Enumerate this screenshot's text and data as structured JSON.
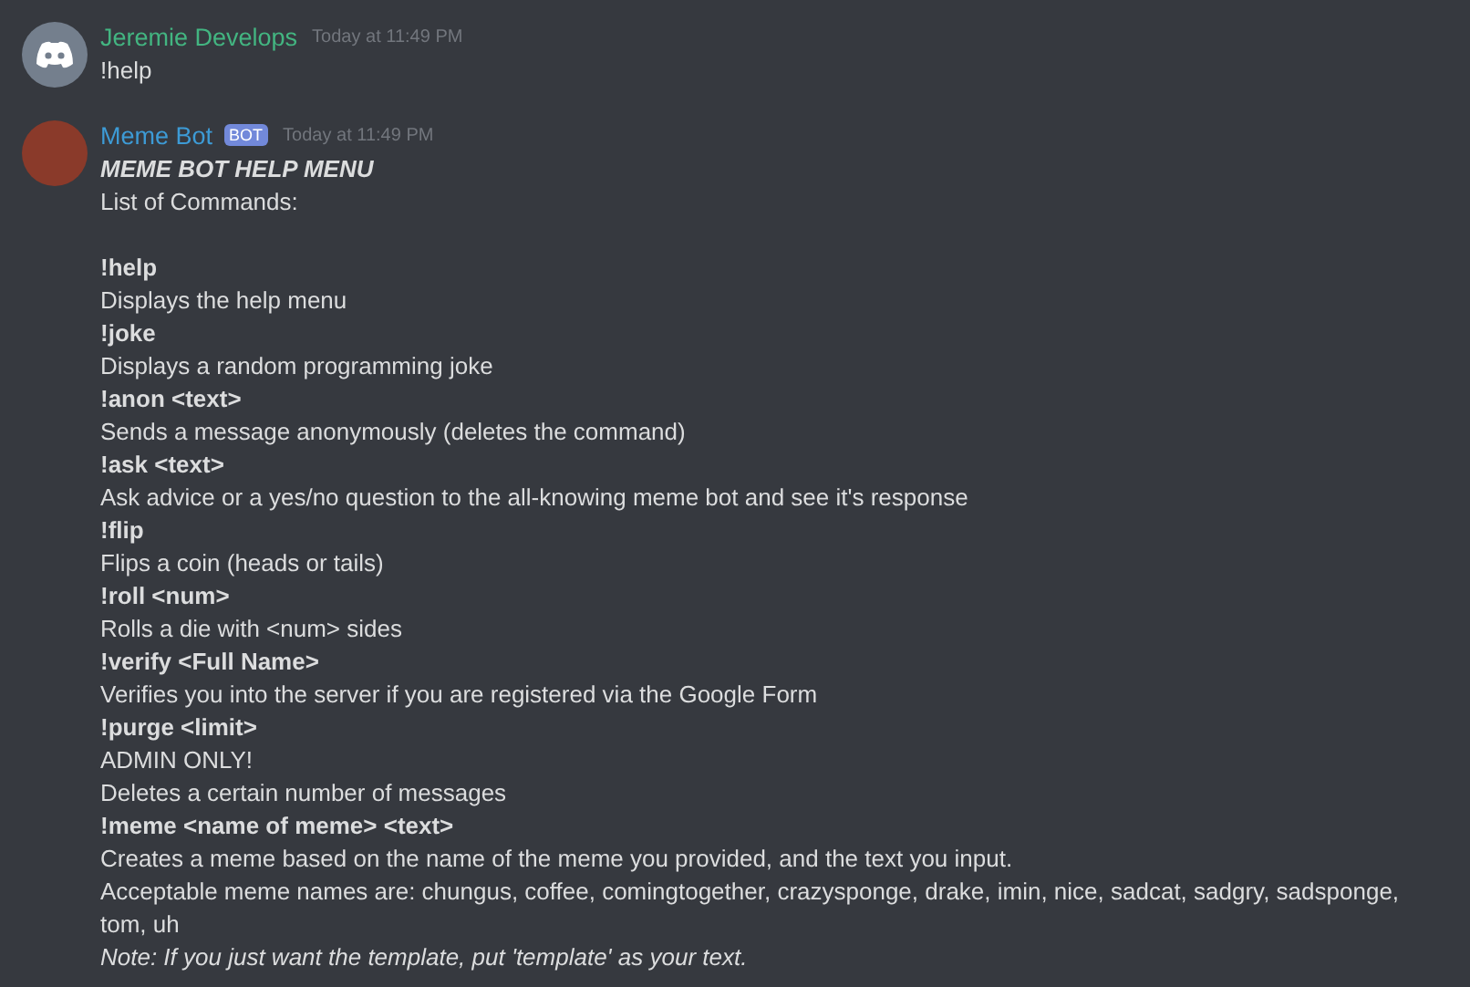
{
  "messages": [
    {
      "author": "Jeremie Develops",
      "color": "#43b581",
      "kind": "logo",
      "timestamp": "Today at 11:49 PM",
      "lines": [
        {
          "kind": "text",
          "text": "!help"
        }
      ]
    },
    {
      "author": "Meme Bot",
      "color": "#3d9bd6",
      "kind": "photo",
      "badge": "BOT",
      "timestamp": "Today at 11:49 PM",
      "lines": [
        {
          "kind": "heading",
          "text": "MEME BOT HELP MENU"
        },
        {
          "kind": "intro",
          "text": "List of Commands:"
        },
        {
          "kind": "command",
          "text": "!help"
        },
        {
          "kind": "text",
          "text": "Displays the help menu"
        },
        {
          "kind": "command",
          "text": "!joke"
        },
        {
          "kind": "text",
          "text": "Displays a random programming joke"
        },
        {
          "kind": "command",
          "text": "!anon <text>"
        },
        {
          "kind": "text",
          "text": "Sends a message anonymously (deletes the command)"
        },
        {
          "kind": "command",
          "text": "!ask <text>"
        },
        {
          "kind": "text",
          "text": "Ask advice or a yes/no question to the all-knowing meme bot and see it's response"
        },
        {
          "kind": "command",
          "text": "!flip"
        },
        {
          "kind": "text",
          "text": "Flips a coin (heads or tails)"
        },
        {
          "kind": "command",
          "text": "!roll <num>"
        },
        {
          "kind": "text",
          "text": "Rolls a die with <num> sides"
        },
        {
          "kind": "command",
          "text": "!verify <Full Name>"
        },
        {
          "kind": "text",
          "text": "Verifies you into the server if you are registered via the Google Form"
        },
        {
          "kind": "command",
          "text": "!purge <limit>"
        },
        {
          "kind": "text",
          "text": "ADMIN ONLY!"
        },
        {
          "kind": "text",
          "text": "Deletes a certain number of messages"
        },
        {
          "kind": "command",
          "text": "!meme <name of meme> <text>"
        },
        {
          "kind": "text",
          "text": "Creates a meme based on the name of the meme you provided, and the text you input."
        },
        {
          "kind": "text",
          "text": "Acceptable meme names are: chungus, coffee, comingtogether, crazysponge, drake, imin, nice, sadcat, sadgry, sadsponge, tom, uh"
        },
        {
          "kind": "note",
          "text": "Note: If you just want the template, put 'template' as your text."
        }
      ]
    }
  ]
}
